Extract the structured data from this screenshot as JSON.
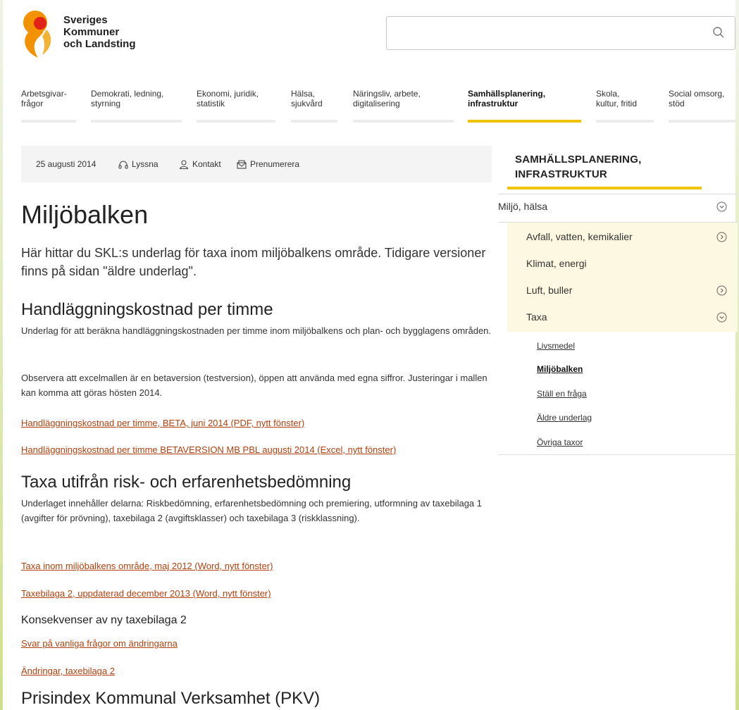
{
  "header": {
    "logo_lines": [
      "Sveriges",
      "Kommuner",
      "och Landsting"
    ],
    "search": {
      "value": "",
      "placeholder": ""
    }
  },
  "nav": [
    {
      "label": "Arbetsgivar-\nfrågor"
    },
    {
      "label": "Demokrati, ledning,\nstyrning"
    },
    {
      "label": "Ekonomi, juridik,\nstatistik"
    },
    {
      "label": "Hälsa,\nsjukvård"
    },
    {
      "label": "Näringsliv, arbete,\ndigitalisering"
    },
    {
      "label": "Samhällsplanering,\ninfrastruktur",
      "active": true
    },
    {
      "label": "Skola,\nkultur, fritid"
    },
    {
      "label": "Social omsorg,\nstöd"
    }
  ],
  "meta": {
    "date": "25 augusti 2014",
    "listen": "Lyssna",
    "contact": "Kontakt",
    "subscribe": "Prenumerera"
  },
  "main": {
    "title": "Miljöbalken",
    "lead": "Här hittar du SKL:s underlag för taxa inom miljöbalkens område. Tidigare versioner finns på sidan \"äldre underlag\".",
    "sections": [
      {
        "heading": "Handläggningskostnad per timme",
        "paragraphs": [
          "Underlag för att beräkna handläggningskostnaden per timme inom miljöbalkens och plan- och bygglagens områden.",
          "Observera att excelmallen är en betaversion (testversion), öppen att använda med egna siffror. Justeringar i mallen kan komma att göras hösten 2014."
        ],
        "links": [
          "Handläggningskostnad per timme, BETA, juni 2014 (PDF, nytt fönster)",
          "Handläggningskostnad per timme BETAVERSION MB PBL augusti 2014 (Excel, nytt fönster)"
        ]
      },
      {
        "heading": "Taxa utifrån risk- och erfarenhetsbedömning",
        "paragraphs": [
          "Underlaget innehåller delarna: Riskbedömning, erfarenhetsbedömning och premiering, utformning av taxebilaga 1 (avgifter för prövning), taxebilaga 2 (avgiftsklasser) och taxebilaga 3 (riskklassning)."
        ],
        "links": [
          "Taxa inom miljöbalkens område, maj 2012 (Word, nytt fönster)",
          "Taxebilaga 2, uppdaterad december 2013 (Word, nytt fönster)"
        ],
        "subheading": "Konsekvenser av ny taxebilaga 2",
        "sublinks": [
          "Svar på vanliga frågor om ändringarna",
          "Ändringar, taxebilaga 2"
        ]
      },
      {
        "heading": "Prisindex Kommunal Verksamhet (PKV)"
      }
    ]
  },
  "sidebar": {
    "heading": "SAMHÄLLSPLANERING, INFRASTRUKTUR",
    "level1": "Miljö, hälsa",
    "level2": [
      "Avfall, vatten, kemikalier",
      "Klimat, energi",
      "Luft, buller",
      "Taxa"
    ],
    "level3": [
      "Livsmedel",
      "Miljöbalken",
      "Ställ en fråga",
      "Äldre underlag",
      "Övriga taxor"
    ],
    "current": "Miljöbalken"
  },
  "colors": {
    "accent": "#f1c200",
    "link": "#b2410e",
    "logo_orange": "#f39200",
    "logo_red": "#e2231a",
    "sidebar_highlight": "#fdf8e1"
  }
}
